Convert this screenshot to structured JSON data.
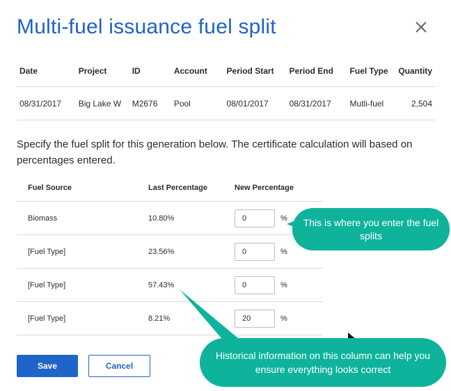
{
  "dialog": {
    "title": "Multi-fuel issuance fuel split"
  },
  "info_table": {
    "headers": [
      "Date",
      "Project",
      "ID",
      "Account",
      "Period Start",
      "Period End",
      "Fuel Type",
      "Quantity"
    ],
    "row": [
      "08/31/2017",
      "Big Lake W",
      "M2676",
      "Pool",
      "08/01/2017",
      "08/31/2017",
      "Mutli-fuel",
      "2,504"
    ]
  },
  "instructions": "Specify the fuel split for this generation below. The certificate calculation will based on percentages entered.",
  "split_table": {
    "headers": [
      "Fuel Source",
      "Last Percentage",
      "New Percentage"
    ],
    "rows": [
      {
        "source": "Biomass",
        "last": "10.80%",
        "new": "0"
      },
      {
        "source": "[Fuel Type]",
        "last": "23.56%",
        "new": "0"
      },
      {
        "source": "[Fuel Type]",
        "last": "57.43%",
        "new": "0"
      },
      {
        "source": "[Fuel Type]",
        "last": "8.21%",
        "new": "20"
      }
    ],
    "percent_sign": "%"
  },
  "buttons": {
    "save": "Save",
    "cancel": "Cancel"
  },
  "callouts": {
    "entry": "This is where you enter the fuel splits",
    "history": "Historical information on this column can help you ensure everything looks correct"
  },
  "colors": {
    "title": "#1e63c6",
    "primary": "#1f64c8",
    "callout": "#0fb39b"
  }
}
